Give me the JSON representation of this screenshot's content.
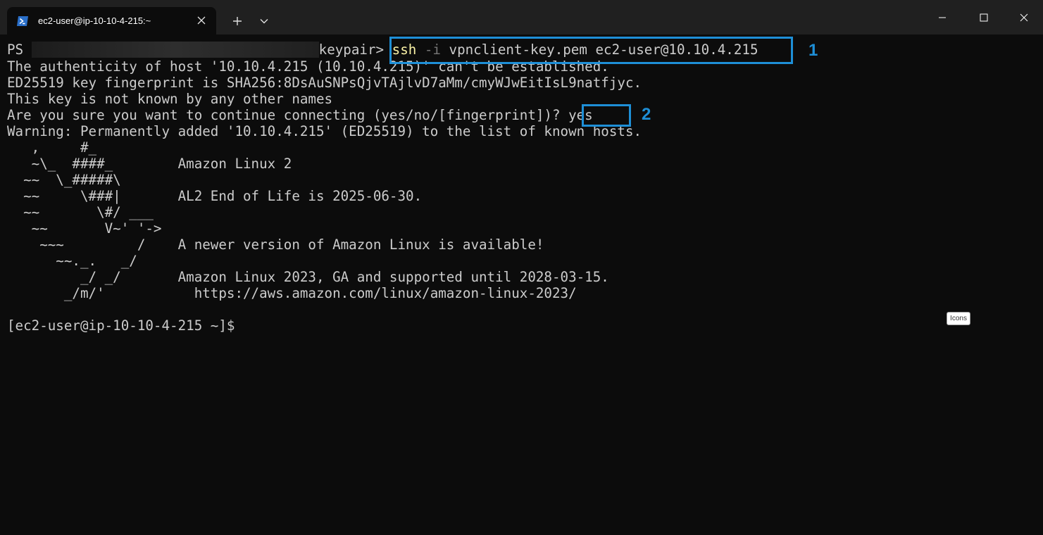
{
  "tab": {
    "title": "ec2-user@ip-10-10-4-215:~",
    "icon": "powershell-icon"
  },
  "window_controls": [
    "minimize-icon",
    "maximize-icon",
    "close-icon"
  ],
  "colors": {
    "background": "#0c0c0c",
    "titlebar": "#202020",
    "text": "#cccccc",
    "command": "#f9f1a5",
    "flag": "#767676",
    "annotation": "#1e8fd7"
  },
  "terminal": {
    "prompt_prefix": "PS ",
    "prompt_suffix": "keypair>",
    "command": {
      "program": "ssh",
      "flag": "-i",
      "args": "vpnclient-key.pem ec2-user@10.10.4.215"
    },
    "auth_line": "The authenticity of host '10.10.4.215 (10.10.4.215)' can't be established.",
    "fingerprint_line": "ED25519 key fingerprint is SHA256:8DsAuSNPsQjvTAjlvD7aMm/cmyWJwEitIsL9natfjyc.",
    "known_line": "This key is not known by any other names",
    "confirm_question": "Are you sure you want to continue connecting (yes/no/[fingerprint])? ",
    "confirm_answer": "yes",
    "warning_line": "Warning: Permanently added '10.10.4.215' (ED25519) to the list of known hosts.",
    "banner": [
      "   ,     #_",
      "   ~\\_  ####_        Amazon Linux 2",
      "  ~~  \\_#####\\",
      "  ~~     \\###|       AL2 End of Life is 2025-06-30.",
      "  ~~       \\#/ ___",
      "   ~~       V~' '->",
      "    ~~~         /    A newer version of Amazon Linux is available!",
      "      ~~._.   _/",
      "         _/ _/       Amazon Linux 2023, GA and supported until 2028-03-15.",
      "       _/m/'           https://aws.amazon.com/linux/amazon-linux-2023/"
    ],
    "final_prompt": "[ec2-user@ip-10-10-4-215 ~]$"
  },
  "annotations": {
    "label_1": "1",
    "label_2": "2"
  },
  "tooltip": "Icons"
}
